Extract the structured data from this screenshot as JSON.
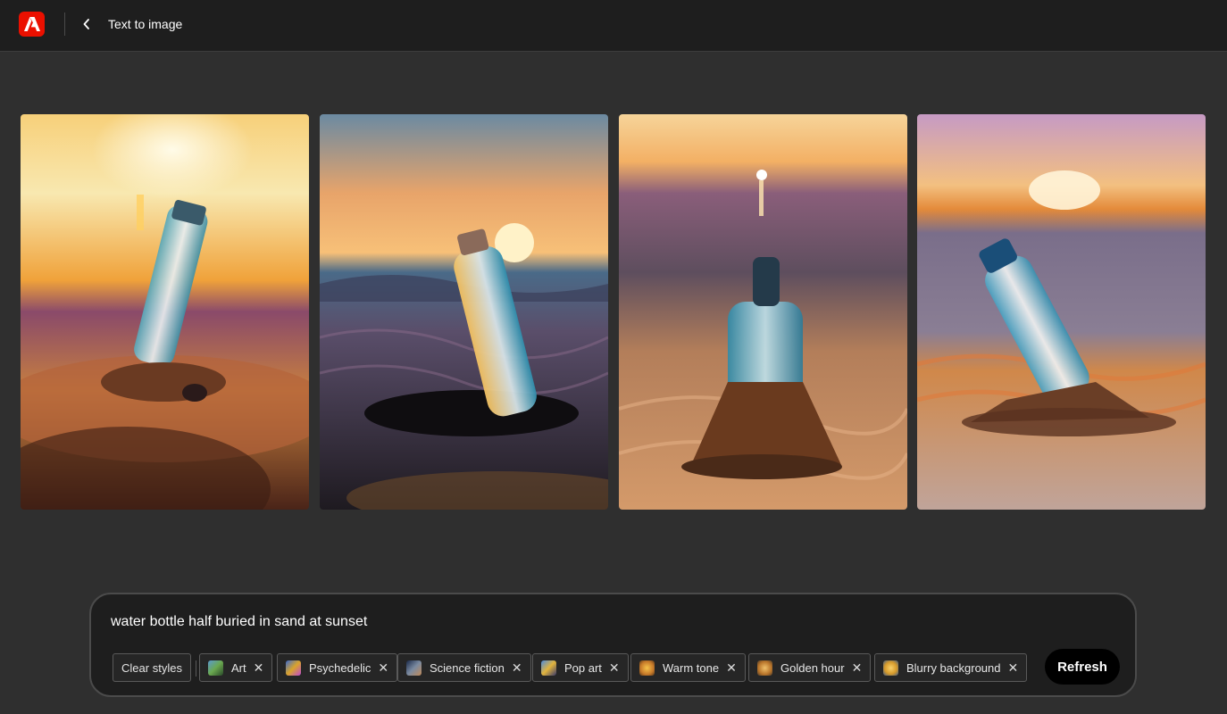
{
  "header": {
    "app_logo": "adobe-logo",
    "back_icon": "chevron-left-icon",
    "title": "Text to image"
  },
  "gallery": {
    "images": [
      {
        "description_icon": "generated-image",
        "palette": [
          "#f6c06a",
          "#d07a3a",
          "#7a4a3a"
        ]
      },
      {
        "description_icon": "generated-image",
        "palette": [
          "#f0a55a",
          "#6a6e88",
          "#2a2a3a"
        ]
      },
      {
        "description_icon": "generated-image",
        "palette": [
          "#f2b272",
          "#9a6a5a",
          "#c58a5a"
        ]
      },
      {
        "description_icon": "generated-image",
        "palette": [
          "#f2a65c",
          "#7a7c94",
          "#c7805a"
        ]
      }
    ]
  },
  "prompt": {
    "text": "water bottle half buried in sand at sunset",
    "clear_styles_label": "Clear styles",
    "chips": [
      {
        "label": "Art",
        "color": "#6aa84f"
      },
      {
        "label": "Psychedelic",
        "color": "#d9a42b"
      },
      {
        "label": "Science fiction",
        "color": "#7a8aa0"
      },
      {
        "label": "Pop art",
        "color": "#e2b43c"
      },
      {
        "label": "Warm tone",
        "color": "#c77a2a"
      },
      {
        "label": "Golden hour",
        "color": "#b8742a"
      },
      {
        "label": "Blurry background",
        "color": "#d69a2a"
      }
    ],
    "remove_icon": "close-icon",
    "refresh_label": "Refresh"
  },
  "colors": {
    "background": "#2f2f2f",
    "topbar": "#1e1e1e",
    "brand": "#eb1000",
    "panel": "#1e1e1e"
  }
}
